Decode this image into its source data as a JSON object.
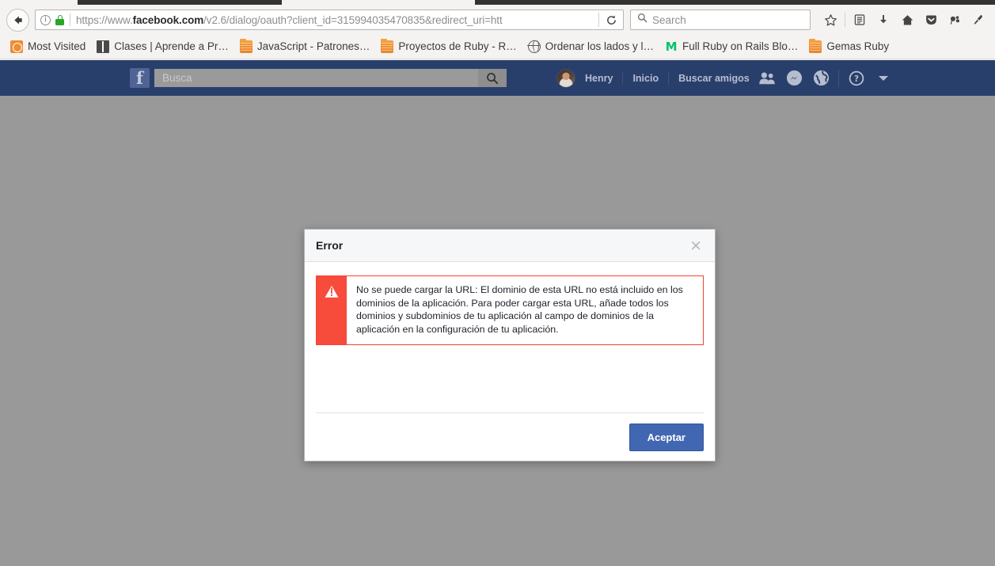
{
  "browser": {
    "back_icon": "back-arrow-icon",
    "identity": {
      "info_icon": "info-icon",
      "lock_icon": "padlock-icon"
    },
    "url": {
      "prefix": "https://www.",
      "domain": "facebook.com",
      "suffix": "/v2.6/dialog/oauth?client_id=315994035470835&redirect_uri=htt",
      "full": "https://www.facebook.com/v2.6/dialog/oauth?client_id=315994035470835&redirect_uri=htt"
    },
    "reload_icon": "reload-icon",
    "search": {
      "icon": "search-icon",
      "placeholder": "Search",
      "value": ""
    },
    "toolbar_icons": [
      {
        "name": "bookmark-star-icon",
        "label": "Bookmark this page"
      },
      {
        "name": "reader-view-icon",
        "label": "Reader view"
      },
      {
        "name": "downloads-icon",
        "label": "Downloads"
      },
      {
        "name": "home-icon",
        "label": "Home"
      },
      {
        "name": "pocket-icon",
        "label": "Pocket"
      },
      {
        "name": "ghostery-icon",
        "label": "Ghostery"
      },
      {
        "name": "eyedropper-icon",
        "label": "Eyedropper"
      }
    ],
    "bookmarks": [
      {
        "label": "Most Visited",
        "icon": "most-visited-icon"
      },
      {
        "label": "Clases | Aprende a Pr…",
        "icon": "book-icon"
      },
      {
        "label": "JavaScript - Patrones…",
        "icon": "folder-icon"
      },
      {
        "label": "Proyectos de Ruby - R…",
        "icon": "folder-icon"
      },
      {
        "label": "Ordenar los lados y l…",
        "icon": "globe-icon"
      },
      {
        "label": "Full Ruby on Rails Blo…",
        "icon": "medium-icon"
      },
      {
        "label": "Gemas Ruby",
        "icon": "folder-icon"
      }
    ]
  },
  "facebook": {
    "logo_glyph": "f",
    "search": {
      "placeholder": "Busca",
      "value": "",
      "button_icon": "search-icon"
    },
    "profile_name": "Henry",
    "nav_links": [
      {
        "label": "Inicio",
        "name": "nav-inicio"
      },
      {
        "label": "Buscar amigos",
        "name": "nav-buscar-amigos"
      }
    ],
    "header_icons": [
      {
        "name": "friend-requests-icon"
      },
      {
        "name": "messenger-icon"
      },
      {
        "name": "notifications-globe-icon"
      },
      {
        "name": "help-icon"
      },
      {
        "name": "account-chevron-down-icon"
      }
    ]
  },
  "dialog": {
    "title": "Error",
    "close_label": "×",
    "error_icon": "warning-triangle-icon",
    "message": "No se puede cargar la URL: El dominio de esta URL no está incluido en los dominios de la aplicación. Para poder cargar esta URL, añade todos los dominios y subdominios de tu aplicación al campo de dominios de la aplicación en la configuración de tu aplicación.",
    "accept_label": "Aceptar"
  },
  "colors": {
    "facebook_blue": "#293f6b",
    "accept_button": "#4267b2",
    "error_red": "#f74c3c",
    "overlay_gray": "#999999",
    "lock_green": "#2aa52a"
  }
}
